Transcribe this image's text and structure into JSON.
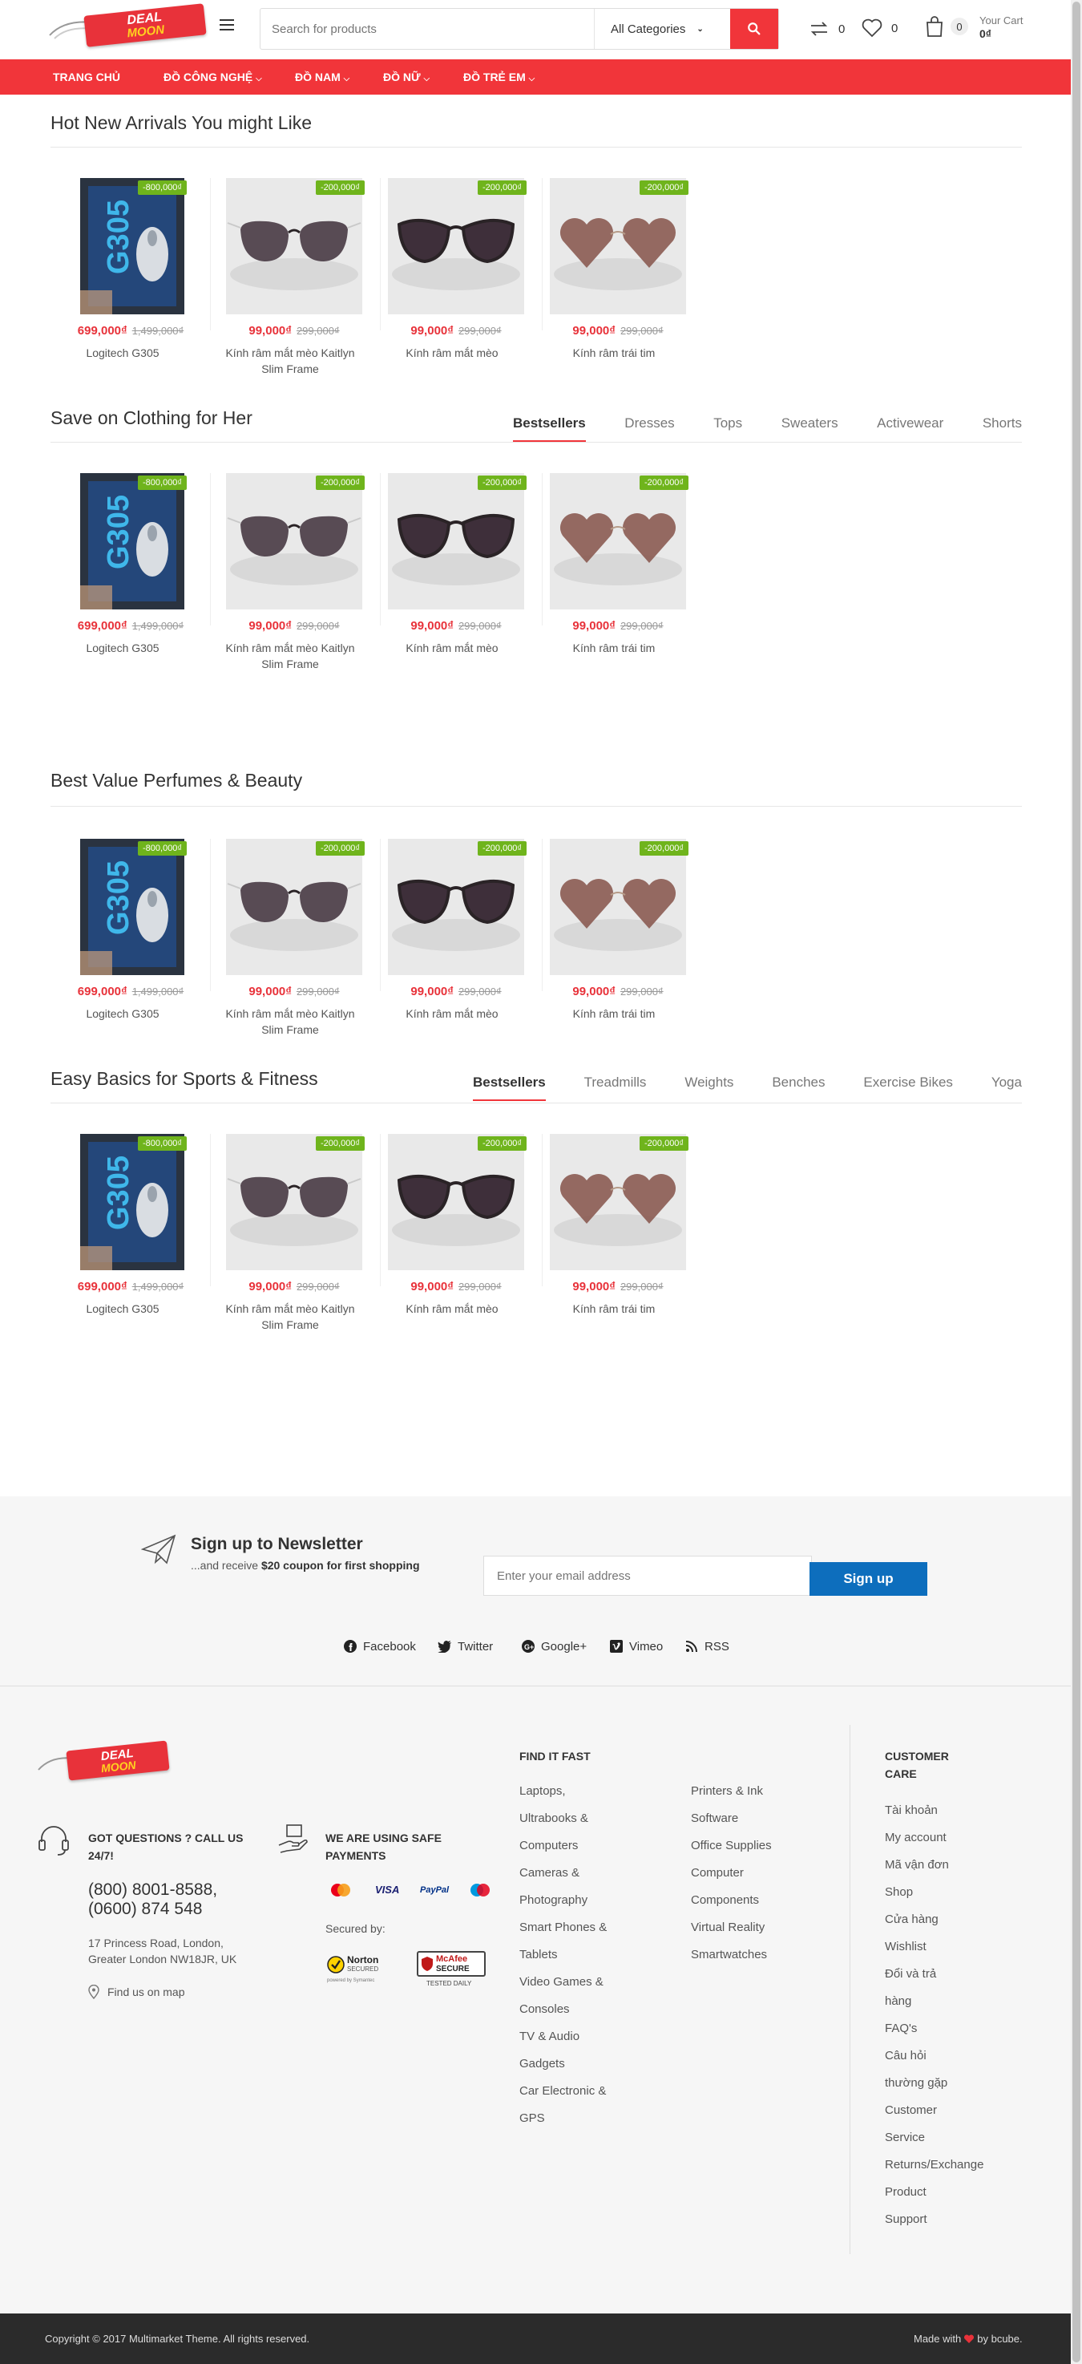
{
  "header": {
    "logo_line1": "DEAL",
    "logo_line2": "MOON",
    "search_placeholder": "Search for products",
    "category_select": "All Categories",
    "compare_count": "0",
    "wishlist_count": "0",
    "cart_count": "0",
    "cart_label": "Your Cart",
    "cart_total": "0₫"
  },
  "nav": {
    "items": [
      {
        "label": "TRANG CHỦ"
      },
      {
        "label": "ĐỒ CÔNG NGHỆ"
      },
      {
        "label": "ĐỒ NAM"
      },
      {
        "label": "ĐỒ NỮ"
      },
      {
        "label": "ĐỒ TRẺ EM"
      }
    ]
  },
  "products": [
    {
      "name": "Logitech G305",
      "price": "699,000₫",
      "old_price": "1,499,000₫",
      "discount": "-800,000₫",
      "image": "mouse"
    },
    {
      "name": "Kính râm mắt mèo Kaitlyn Slim Frame",
      "price": "99,000₫",
      "old_price": "299,000₫",
      "discount": "-200,000₫",
      "image": "sunglasses-square"
    },
    {
      "name": "Kính râm mắt mèo",
      "price": "99,000₫",
      "old_price": "299,000₫",
      "discount": "-200,000₫",
      "image": "sunglasses-cat"
    },
    {
      "name": "Kính râm trái tim",
      "price": "99,000₫",
      "old_price": "299,000₫",
      "discount": "-200,000₫",
      "image": "sunglasses-heart"
    }
  ],
  "sections": [
    {
      "title": "Hot New Arrivals You might Like",
      "tabs": []
    },
    {
      "title": "Save on Clothing for Her",
      "tabs": [
        "Bestsellers",
        "Dresses",
        "Tops",
        "Sweaters",
        "Activewear",
        "Shorts"
      ]
    },
    {
      "title": "Best Value Perfumes & Beauty",
      "tabs": []
    },
    {
      "title": "Easy Basics for Sports & Fitness",
      "tabs": [
        "Bestsellers",
        "Treadmills",
        "Weights",
        "Benches",
        "Exercise Bikes",
        "Yoga"
      ]
    }
  ],
  "newsletter": {
    "title": "Sign up to Newsletter",
    "subtitle_prefix": "...and receive ",
    "subtitle_bold": "$20 coupon for first shopping",
    "placeholder": "Enter your email address",
    "button": "Sign up"
  },
  "social": [
    {
      "label": "Facebook",
      "icon": "facebook-icon"
    },
    {
      "label": "Twitter",
      "icon": "twitter-icon"
    },
    {
      "label": "Google+",
      "icon": "google-plus-icon"
    },
    {
      "label": "Vimeo",
      "icon": "vimeo-icon"
    },
    {
      "label": "RSS",
      "icon": "rss-icon"
    }
  ],
  "footer": {
    "questions_heading": "GOT QUESTIONS ? CALL US 24/7!",
    "phone1": "(800) 8001-8588,",
    "phone2": "(0600) 874 548",
    "address": "17 Princess Road, London, Greater London NW18JR, UK",
    "map_link": "Find us on map",
    "payments_heading": "WE ARE USING SAFE PAYMENTS",
    "secured_by": "Secured by:",
    "pay_visa": "VISA",
    "pay_paypal": "PayPal",
    "norton": "Norton",
    "norton_sub": "SECURED",
    "norton_powered": "powered by Symantec",
    "mcafee": "McAfee",
    "mcafee_sub": "SECURE",
    "mcafee_tested": "TESTED DAILY",
    "find_heading": "FIND IT FAST",
    "find_col1": [
      "Laptops,",
      "Ultrabooks &",
      "Computers",
      "Cameras &",
      "Photography",
      "Smart Phones &",
      "Tablets",
      "Video Games &",
      "Consoles",
      "TV & Audio",
      "Gadgets",
      "Car Electronic &",
      "GPS"
    ],
    "find_col2": [
      "Printers & Ink",
      "Software",
      "Office Supplies",
      "Computer",
      "Components",
      "Virtual Reality",
      "Smartwatches"
    ],
    "care_heading_1": "CUSTOMER",
    "care_heading_2": "CARE",
    "care_links": [
      "Tài khoản",
      "My account",
      "Mã vận đơn",
      "Shop",
      "Cửa hàng",
      "Wishlist",
      "Đổi và trả",
      "hàng",
      "FAQ's",
      "Câu hỏi",
      "thường gặp",
      "Customer",
      "Service",
      "Returns/Exchange",
      "Product",
      "Support"
    ]
  },
  "bottom": {
    "copyright": "Copyright © 2017 Multimarket Theme. All rights reserved.",
    "made_with": "Made with",
    "by": "by bcube."
  },
  "colors": {
    "brand_red": "#f1353a",
    "discount_green": "#6fb41c",
    "signup_blue": "#0d6ebd"
  }
}
